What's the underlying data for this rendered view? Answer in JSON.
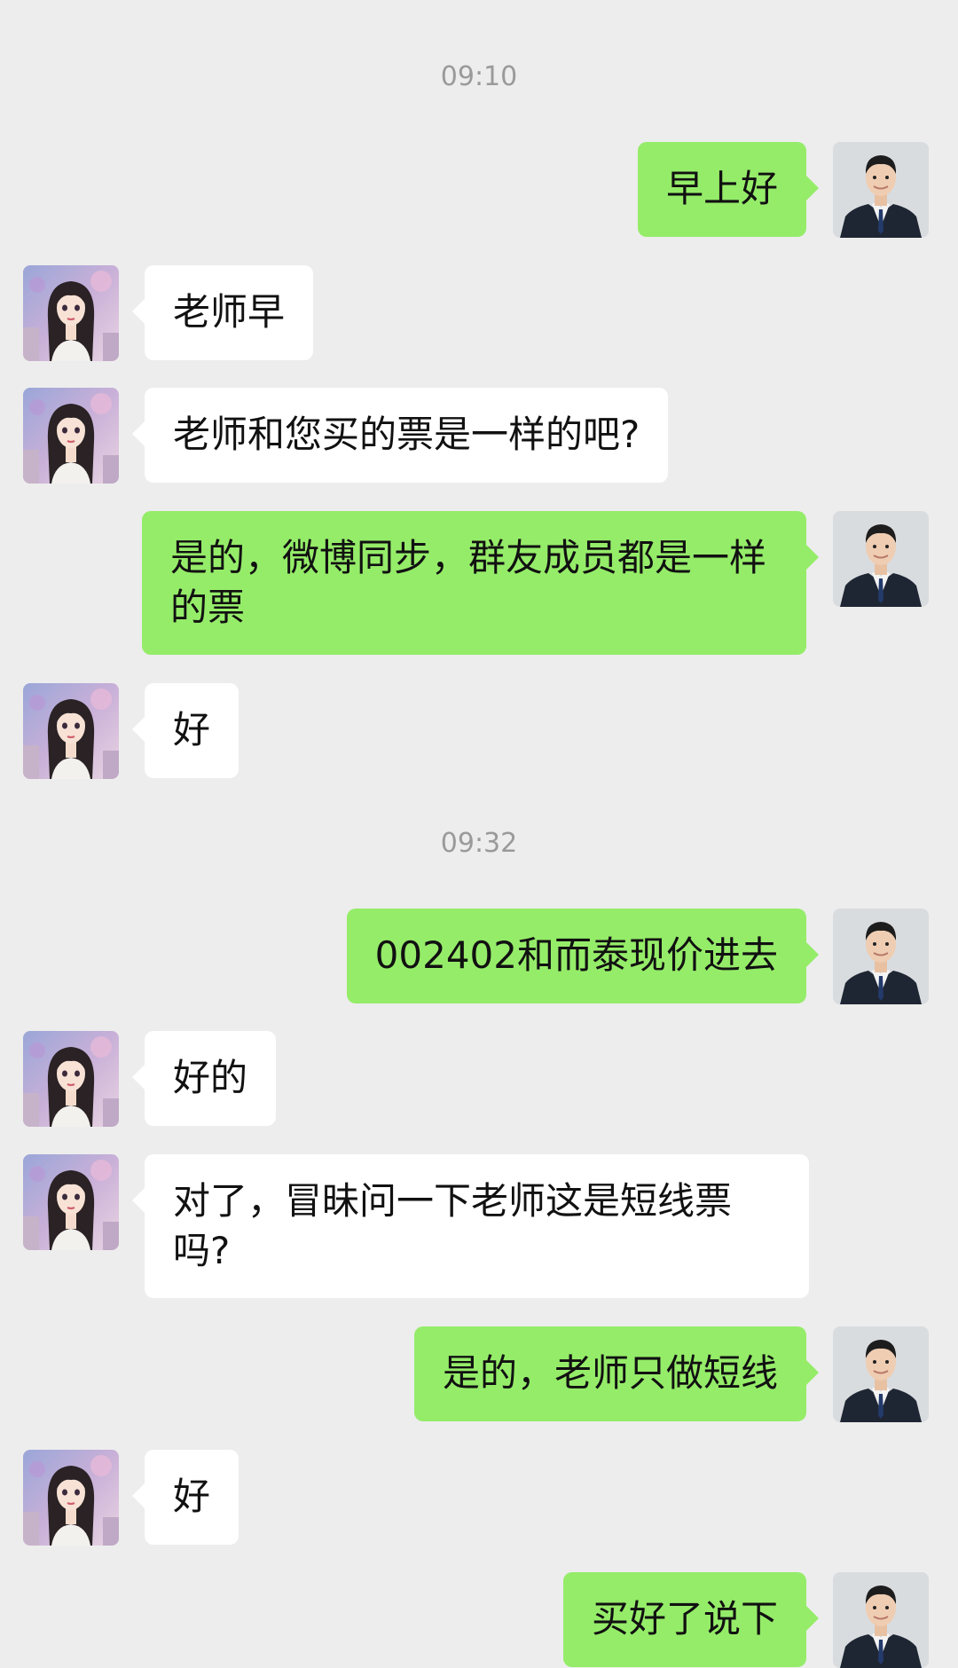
{
  "colors": {
    "background": "#ededed",
    "bubble_out": "#95ec69",
    "bubble_in": "#ffffff",
    "timestamp": "#9a9a9a"
  },
  "timestamps": [
    "09:10",
    "09:32"
  ],
  "messages": [
    {
      "side": "out",
      "text": "早上好",
      "avatar": "man-in-suit-avatar"
    },
    {
      "side": "in",
      "text": "老师早",
      "avatar": "anime-girl-avatar"
    },
    {
      "side": "in",
      "text": "老师和您买的票是一样的吧?",
      "avatar": "anime-girl-avatar"
    },
    {
      "side": "out",
      "text": "是的，微博同步，群友成员都是一样的票",
      "avatar": "man-in-suit-avatar"
    },
    {
      "side": "in",
      "text": "好",
      "avatar": "anime-girl-avatar"
    },
    {
      "side": "out",
      "text": "002402和而泰现价进去",
      "avatar": "man-in-suit-avatar"
    },
    {
      "side": "in",
      "text": "好的",
      "avatar": "anime-girl-avatar"
    },
    {
      "side": "in",
      "text": "对了，冒昧问一下老师这是短线票吗?",
      "avatar": "anime-girl-avatar"
    },
    {
      "side": "out",
      "text": "是的，老师只做短线",
      "avatar": "man-in-suit-avatar"
    },
    {
      "side": "in",
      "text": "好",
      "avatar": "anime-girl-avatar"
    },
    {
      "side": "out",
      "text": "买好了说下",
      "avatar": "man-in-suit-avatar"
    }
  ]
}
